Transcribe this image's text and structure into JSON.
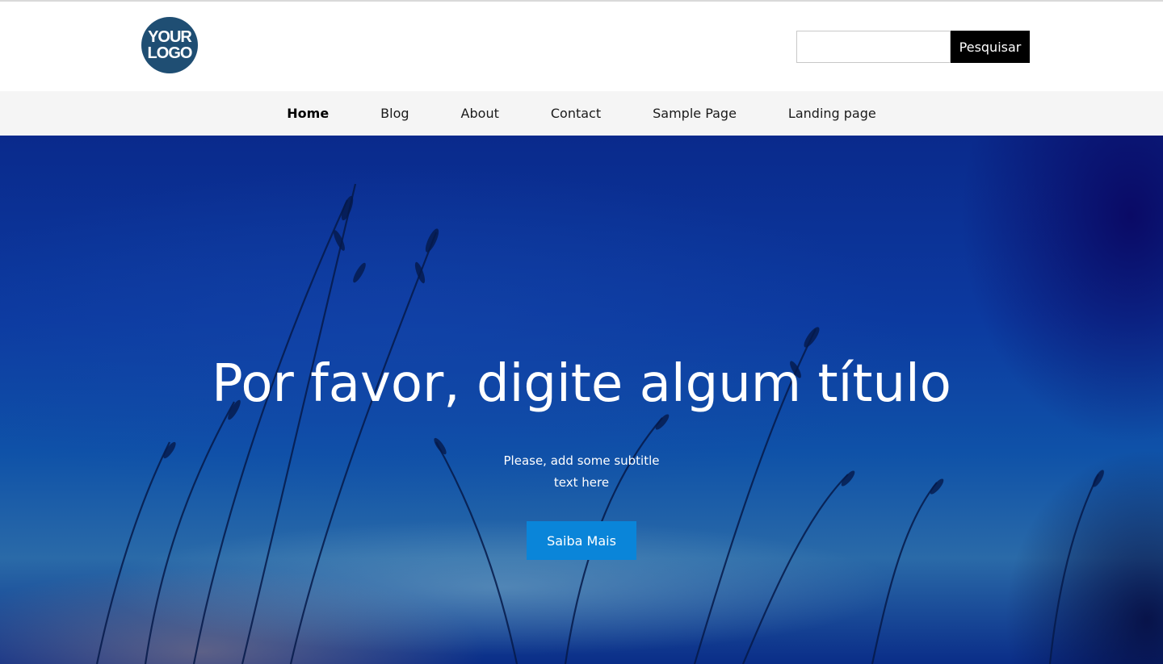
{
  "header": {
    "logo_line1": "YOUR",
    "logo_line2": "LOGO",
    "search": {
      "value": "",
      "placeholder": "",
      "button_label": "Pesquisar"
    }
  },
  "nav": {
    "items": [
      {
        "label": "Home",
        "active": true
      },
      {
        "label": "Blog"
      },
      {
        "label": "About"
      },
      {
        "label": "Contact"
      },
      {
        "label": "Sample Page"
      },
      {
        "label": "Landing page"
      }
    ]
  },
  "hero": {
    "title": "Por favor, digite algum título",
    "subtitle": "Please, add some subtitle text here",
    "button_label": "Saiba Mais"
  },
  "colors": {
    "logo_bg": "#1f4e73",
    "search_button_bg": "#000000",
    "nav_bg": "#f5f5f5",
    "hero_bg": "#0c3aa0",
    "cta_bg": "#0a85d9"
  }
}
